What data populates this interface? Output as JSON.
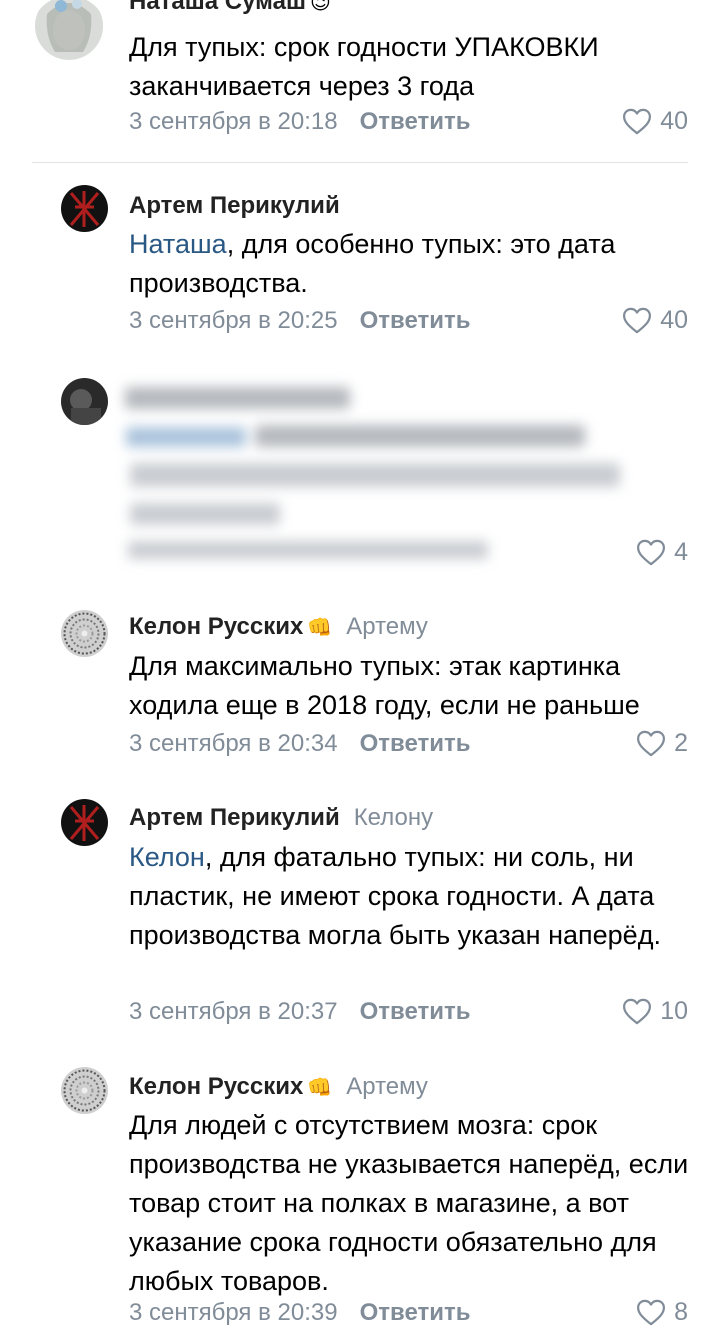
{
  "comments": [
    {
      "author": "Наташа Сумаш",
      "emoji": "😉",
      "reply_to": "",
      "mention": "",
      "text": "Для тупых: срок годности УПАКОВКИ заканчивается через 3 года",
      "date": "3 сентября в 20:18",
      "reply_label": "Ответить",
      "likes": "40"
    },
    {
      "author": "Артем Перикулий",
      "reply_to": "",
      "mention": "Наташа",
      "text": ", для особенно тупых: это дата производства.",
      "date": "3 сентября в 20:25",
      "reply_label": "Ответить",
      "likes": "40"
    },
    {
      "author": "",
      "likes": "4"
    },
    {
      "author": "Келон Русских",
      "emoji": "👊",
      "reply_to": "Артему",
      "text": "Для максимально тупых: этак картинка ходила еще в 2018 году, если не раньше",
      "date": "3 сентября в 20:34",
      "reply_label": "Ответить",
      "likes": "2"
    },
    {
      "author": "Артем Перикулий",
      "reply_to": "Келону",
      "mention": "Келон",
      "text": ", для фатально тупых: ни соль, ни пластик, не имеют срока годности. А дата производства могла быть указан наперёд.",
      "date": "3 сентября в 20:37",
      "reply_label": "Ответить",
      "likes": "10"
    },
    {
      "author": "Келон Русских",
      "emoji": "👊",
      "reply_to": "Артему",
      "text": "Для людей с отсутствием мозга: срок производства не указывается наперёд, если товар стоит на полках в магазине, а вот указание срока годности обязательно для любых товаров.",
      "date": "3 сентября в 20:39",
      "reply_label": "Ответить",
      "likes": "8"
    }
  ],
  "colors": {
    "link": "#2a5885",
    "secondary": "#818c99",
    "divider": "#e1e3e6"
  },
  "icons": {
    "like": "heart-outline-icon"
  }
}
